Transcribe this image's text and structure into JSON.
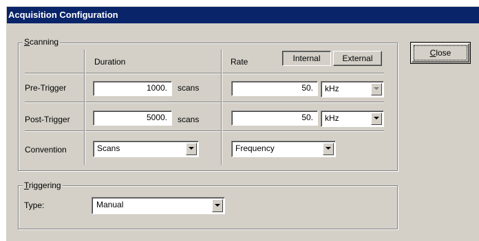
{
  "window": {
    "title": "Acquisition Configuration"
  },
  "scanning": {
    "legend_letter": "S",
    "legend_rest": "canning",
    "columns": {
      "duration": "Duration",
      "rate": "Rate"
    },
    "clock_source": {
      "internal": "Internal",
      "external": "External",
      "selected": "Internal"
    },
    "rows": {
      "pre_trigger": {
        "label": "Pre-Trigger",
        "duration": "1000.",
        "duration_unit": "scans",
        "rate": "50.",
        "rate_unit": "kHz",
        "rate_unit_enabled": false
      },
      "post_trigger": {
        "label": "Post-Trigger",
        "duration": "5000.",
        "duration_unit": "scans",
        "rate": "50.",
        "rate_unit": "kHz",
        "rate_unit_enabled": true
      },
      "convention": {
        "label": "Convention",
        "duration": "Scans",
        "rate": "Frequency"
      }
    }
  },
  "triggering": {
    "legend_letter": "T",
    "legend_rest": "riggering",
    "type_label": "Type:",
    "type_value": "Manual"
  },
  "buttons": {
    "close_letter": "C",
    "close_rest": "lose"
  },
  "colors": {
    "titlebar": "#0a246a",
    "face": "#d4d0c8"
  }
}
